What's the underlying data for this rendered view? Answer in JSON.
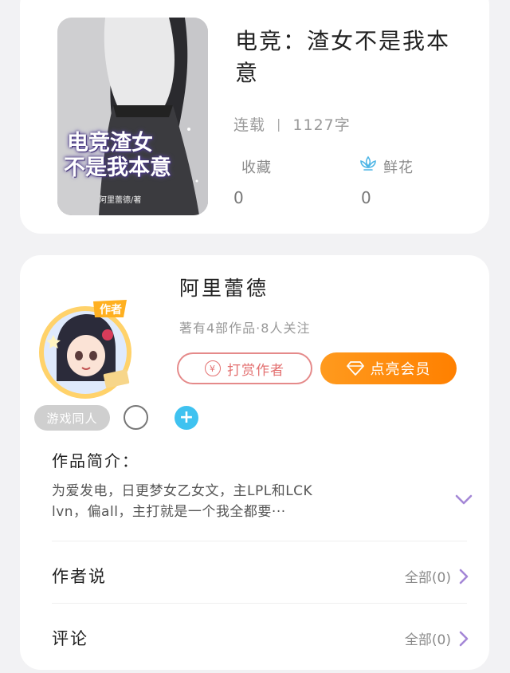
{
  "book": {
    "cover_title_line1": "电竞渣女",
    "cover_title_line2": "不是我本意",
    "cover_author": "阿里蕾德/著",
    "title": "电竞：渣女不是我本意",
    "status": "连载",
    "separator": "|",
    "word_count": "1127字",
    "collect_label": "收藏",
    "collect_count": "0",
    "flower_label": "鲜花",
    "flower_count": "0"
  },
  "author": {
    "badge": "作者",
    "name": "阿里蕾德",
    "info": "著有4部作品·8人关注",
    "tip_coin": "¥",
    "tip_button": "打赏作者",
    "vip_button": "点亮会员",
    "tag": "游戏同人",
    "plus": "+",
    "intro_label": "作品简介：",
    "intro_line1": "为爱发电，日更梦女乙女文，主LPL和LCK",
    "intro_line2": "lvn，偏all，主打就是一个我全都要···"
  },
  "sections": [
    {
      "label": "作者说",
      "right": "全部(0)"
    },
    {
      "label": "评论",
      "right": "全部(0)"
    }
  ],
  "colors": {
    "accent_orange": "#ff8a00",
    "tip_red": "#e37070",
    "chevron_purple": "#a487d6",
    "plus_blue": "#3fc2f0",
    "flower_blue": "#4fb6e6"
  },
  "icons": [
    "flower-icon",
    "coin-icon",
    "diamond-icon",
    "chevron-down-icon",
    "chevron-right-icon",
    "plus-icon"
  ]
}
